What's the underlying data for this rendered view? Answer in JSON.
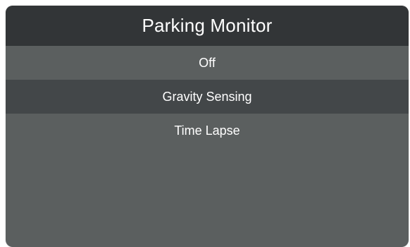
{
  "header": {
    "title": "Parking Monitor"
  },
  "menu": {
    "selected_index": 1,
    "items": [
      {
        "label": "Off"
      },
      {
        "label": "Gravity Sensing"
      },
      {
        "label": "Time Lapse"
      }
    ]
  },
  "colors": {
    "panel_background": "#5b5f5f",
    "title_background": "#323537",
    "selected_row_background": "#434749",
    "text": "#ffffff"
  }
}
